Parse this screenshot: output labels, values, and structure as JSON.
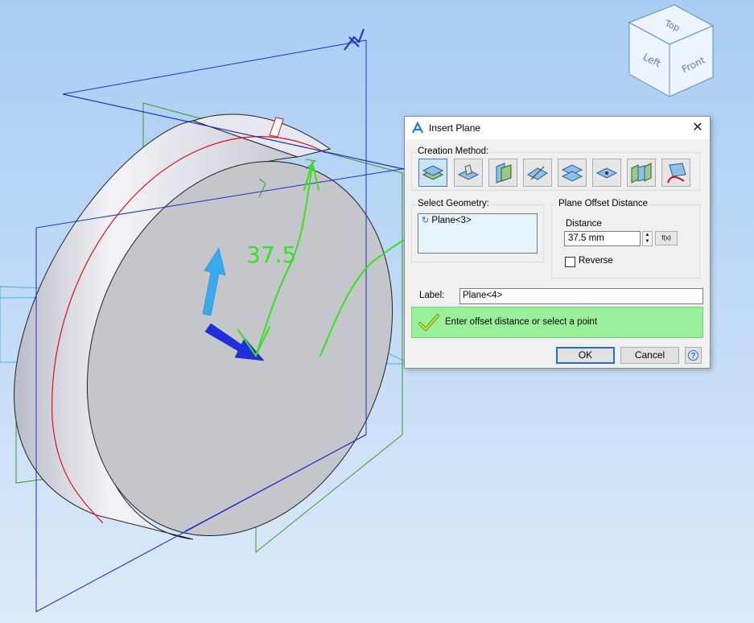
{
  "dialog": {
    "title": "Insert Plane",
    "creation_method_label": "Creation Method:",
    "creation_methods": [
      "offset-plane",
      "tangent-plane",
      "normal-plane",
      "angle-plane",
      "parallel-planes",
      "point-plane",
      "mid-plane",
      "curve-plane"
    ],
    "select_geometry_label": "Select Geometry:",
    "selected_geometry": "Plane<3>",
    "offset_group_label": "Plane Offset Distance",
    "distance_label": "Distance",
    "distance_value": "37.5 mm",
    "fx_label": "f(x)",
    "reverse_label": "Reverse",
    "reverse_checked": false,
    "label_field_label": "Label:",
    "label_value": "Plane<4>",
    "status_message": "Enter offset distance or select a point",
    "ok_label": "OK",
    "cancel_label": "Cancel",
    "help_label": "?"
  },
  "view_cube": {
    "top": "Top",
    "left": "Left",
    "front": "Front"
  },
  "annotation": {
    "dimension_text": "37.5",
    "color": "#35e21f"
  },
  "colors": {
    "plane_outline": "#1b2fc4",
    "green_plane": "#3a9a2a",
    "cyan_plane": "#3fb3e6",
    "edge_red": "#e01010",
    "arrow_blue": "#1f2fe0",
    "arrow_cyan": "#39a9f0"
  }
}
